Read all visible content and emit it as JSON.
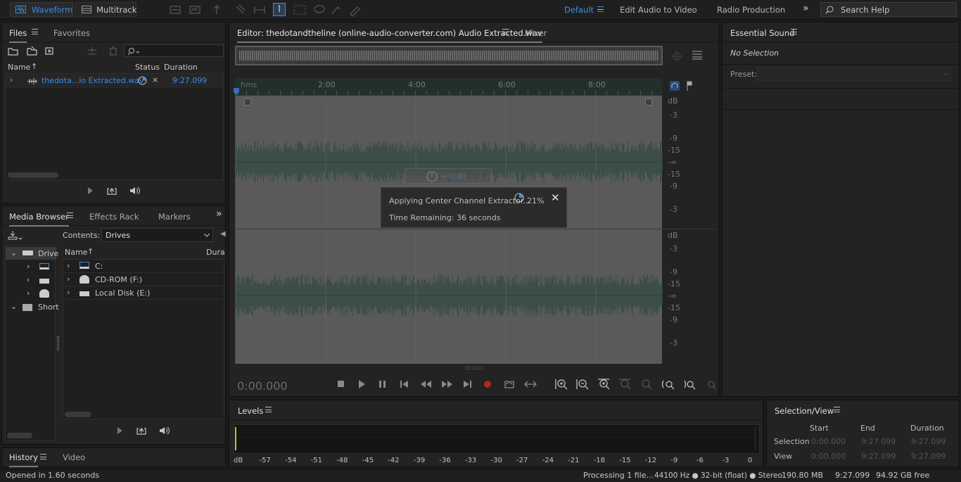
{
  "toolbar": {
    "waveform_label": "Waveform",
    "multitrack_label": "Multitrack",
    "workspaces": [
      "Default",
      "Edit Audio to Video",
      "Radio Production"
    ],
    "search_placeholder": "Search Help"
  },
  "files_panel": {
    "tabs": [
      "Files",
      "Favorites"
    ],
    "columns": {
      "name": "Name",
      "status": "Status",
      "duration": "Duration"
    },
    "file": {
      "name": "thedota...io Extracted.wav",
      "duration": "9:27.099"
    }
  },
  "media_browser": {
    "tabs": [
      "Media Browser",
      "Effects Rack",
      "Markers"
    ],
    "contents_label": "Contents:",
    "contents_value": "Drives",
    "tree": [
      "Drive",
      "Short"
    ],
    "columns": {
      "name": "Name",
      "duration": "Dura"
    },
    "drives": [
      "C:",
      "CD-ROM (F:)",
      "Local Disk (E:)"
    ]
  },
  "history_panel": {
    "tabs": [
      "History",
      "Video"
    ]
  },
  "editor": {
    "tab_title": "Editor: thedotandtheline (online-audio-converter.com) Audio Extracted.wav",
    "mixer_label": "Mixer",
    "ruler": [
      "hms",
      "2:00",
      "4:00",
      "6:00",
      "8:00"
    ],
    "db_scale_top": [
      "dB",
      "-3",
      "-9",
      "-15",
      "-∞",
      "-15",
      "-9",
      "-3"
    ],
    "db_scale_bottom": [
      "dB",
      "-3",
      "-9",
      "-15",
      "-∞",
      "-15",
      "-9",
      "-3"
    ],
    "time_display": "0:00.000",
    "hud_gain": "+0 dB"
  },
  "progress_dialog": {
    "message": "Applying Center Channel Extractor...",
    "percent": "21%",
    "remaining": "Time Remaining: 36 seconds"
  },
  "essential_sound": {
    "title": "Essential Sound",
    "selection": "No Selection",
    "preset_label": "Preset:"
  },
  "levels": {
    "title": "Levels",
    "scale": [
      "dB",
      "-57",
      "-54",
      "-51",
      "-48",
      "-45",
      "-42",
      "-39",
      "-36",
      "-33",
      "-30",
      "-27",
      "-24",
      "-21",
      "-18",
      "-15",
      "-12",
      "-9",
      "-6",
      "-3",
      "0"
    ]
  },
  "selection_view": {
    "title": "Selection/View",
    "columns": [
      "Start",
      "End",
      "Duration"
    ],
    "rows": [
      {
        "label": "Selection",
        "start": "0:00.000",
        "end": "9:27.099",
        "duration": "9:27.099"
      },
      {
        "label": "View",
        "start": "0:00.000",
        "end": "9:27.099",
        "duration": "9:27.099"
      }
    ]
  },
  "status_bar": {
    "left": "Opened in 1.60 seconds",
    "processing": "Processing 1 file...",
    "format": "44100 Hz ● 32-bit (float) ● Stereo",
    "size": "190.80 MB",
    "duration": "9:27.099",
    "free": "94.92 GB free"
  },
  "colors": {
    "accent": "#3a8ee6",
    "waveform": "#3a4d47",
    "waveform_bg": "#5a5a5a",
    "record": "#b3261e"
  }
}
